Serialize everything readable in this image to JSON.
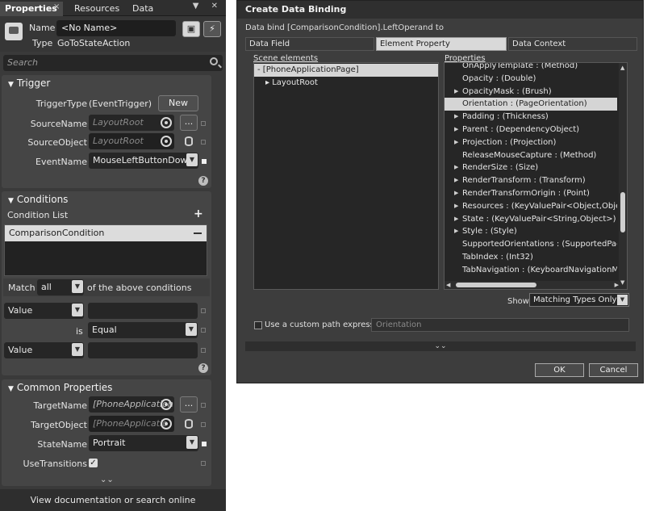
{
  "properties_panel": {
    "tabs": [
      {
        "label": "Properties"
      },
      {
        "label": "Resources"
      },
      {
        "label": "Data"
      }
    ],
    "tab_close": "×",
    "header_icons": "▼ ✕",
    "name_label": "Name",
    "name_value": "<No Name>",
    "type_label": "Type",
    "type_value": "GoToStateAction",
    "search_placeholder": "Search",
    "trigger": {
      "title": "Trigger",
      "trigger_type_label": "TriggerType",
      "trigger_type_value": "(EventTrigger)",
      "new_button": "New",
      "source_name_label": "SourceName",
      "source_name_value": "LayoutRoot",
      "source_object_label": "SourceObject",
      "source_object_value": "LayoutRoot",
      "event_name_label": "EventName",
      "event_name_value": "MouseLeftButtonDow",
      "dots": "..."
    },
    "conditions": {
      "title": "Conditions",
      "list_label": "Condition List",
      "add_symbol": "+",
      "items": [
        "ComparisonCondition"
      ],
      "match_label": "Match",
      "match_value": "all",
      "match_suffix": "of the above conditions",
      "left_operand_type": "Value",
      "operator_label": "is",
      "operator_value": "Equal",
      "right_operand_type": "Value"
    },
    "common": {
      "title": "Common Properties",
      "target_name_label": "TargetName",
      "target_name_value": "[PhoneApplication",
      "target_object_label": "TargetObject",
      "target_object_value": "[PhoneApplicatio",
      "state_name_label": "StateName",
      "state_name_value": "Portrait",
      "use_transitions_label": "UseTransitions",
      "use_transitions_checked": true,
      "dots": "..."
    },
    "footer": {
      "prefix": "View documentation",
      "or": "or",
      "suffix": "search online"
    },
    "help_symbol": "?",
    "expand_symbol": "⌄⌄"
  },
  "dialog": {
    "title": "Create Data Binding",
    "subtitle": "Data bind [ComparisonCondition].LeftOperand to",
    "tabs": [
      "Data Field",
      "Element Property",
      "Data Context"
    ],
    "active_tab": "Element Property",
    "scene_label": "Scene elements",
    "scene_items": [
      {
        "text": "[PhoneApplicationPage]",
        "selected": true,
        "expander": "-"
      },
      {
        "text": "LayoutRoot",
        "selected": false,
        "expander": "▸"
      }
    ],
    "properties_label": "Properties",
    "properties": [
      {
        "text": "OnApplyTemplate : (Method)",
        "arrow": ""
      },
      {
        "text": "Opacity : (Double)",
        "arrow": ""
      },
      {
        "text": "OpacityMask : (Brush)",
        "arrow": "▶"
      },
      {
        "text": "Orientation : (PageOrientation)",
        "arrow": "",
        "selected": true
      },
      {
        "text": "Padding : (Thickness)",
        "arrow": "▶"
      },
      {
        "text": "Parent : (DependencyObject)",
        "arrow": "▶"
      },
      {
        "text": "Projection : (Projection)",
        "arrow": "▶"
      },
      {
        "text": "ReleaseMouseCapture : (Method)",
        "arrow": ""
      },
      {
        "text": "RenderSize : (Size)",
        "arrow": "▶"
      },
      {
        "text": "RenderTransform : (Transform)",
        "arrow": "▶"
      },
      {
        "text": "RenderTransformOrigin : (Point)",
        "arrow": "▶"
      },
      {
        "text": "Resources : (KeyValuePair<Object,Object>)",
        "arrow": "▶"
      },
      {
        "text": "State : (KeyValuePair<String,Object>)",
        "arrow": "▶"
      },
      {
        "text": "Style : (Style)",
        "arrow": "▶"
      },
      {
        "text": "SupportedOrientations : (SupportedPageOri",
        "arrow": ""
      },
      {
        "text": "TabIndex : (Int32)",
        "arrow": ""
      },
      {
        "text": "TabNavigation : (KeyboardNavigationMode)",
        "arrow": ""
      }
    ],
    "show_label": "Show",
    "show_value": "Matching Types Only",
    "custom_path_label": "Use a custom path expression",
    "custom_path_value": "Orientation",
    "expand_symbol": "⌄⌄",
    "ok": "OK",
    "cancel": "Cancel"
  },
  "colors": {
    "panel_bg": "#3a3a3a",
    "section_bg": "#454545",
    "field_bg": "#262626",
    "selection_bg": "#d5d5d5"
  }
}
